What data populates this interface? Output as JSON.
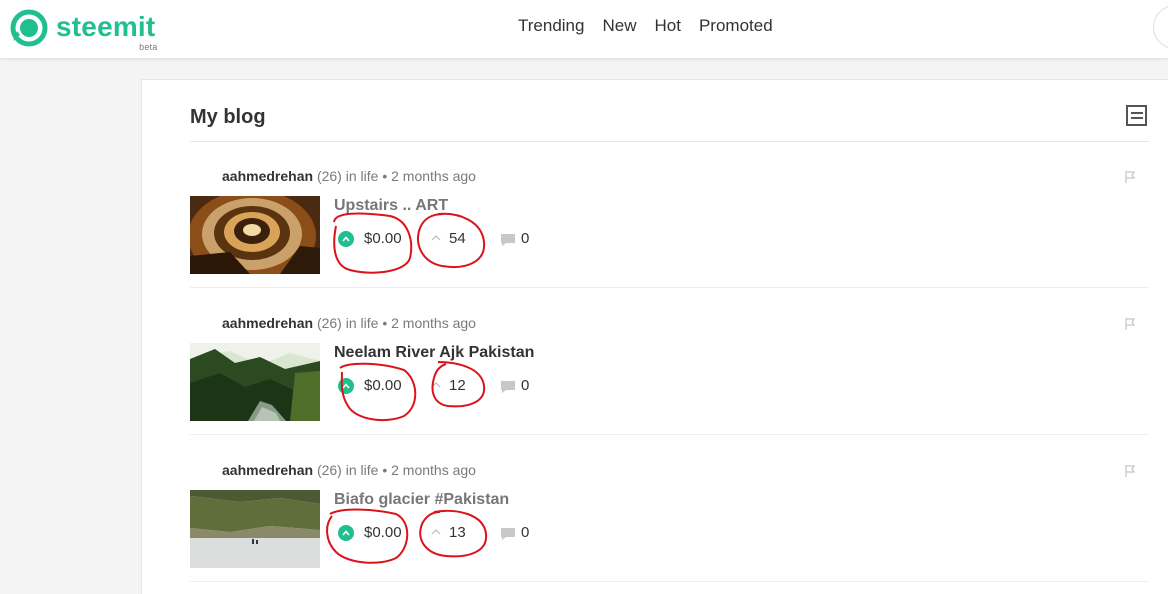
{
  "header": {
    "brand": "steemit",
    "brand_badge": "beta",
    "nav": [
      "Trending",
      "New",
      "Hot",
      "Promoted"
    ]
  },
  "blog": {
    "title": "My blog",
    "posts": [
      {
        "author": "aahmedrehan",
        "reputation": "(26)",
        "category_prefix": "in",
        "category": "life",
        "separator": "•",
        "time": "2 months ago",
        "title": "Upstairs .. ART",
        "payout": "$0.00",
        "voters": "54",
        "comments": "0"
      },
      {
        "author": "aahmedrehan",
        "reputation": "(26)",
        "category_prefix": "in",
        "category": "life",
        "separator": "•",
        "time": "2 months ago",
        "title": "Neelam River Ajk Pakistan",
        "payout": "$0.00",
        "voters": "12",
        "comments": "0"
      },
      {
        "author": "aahmedrehan",
        "reputation": "(26)",
        "category_prefix": "in",
        "category": "life",
        "separator": "•",
        "time": "2 months ago",
        "title": "Biafo glacier #Pakistan",
        "payout": "$0.00",
        "voters": "13",
        "comments": "0"
      }
    ]
  },
  "colors": {
    "brand": "#1fbf8f",
    "annotation": "#d9141b"
  },
  "icons": [
    "steemit-logo-icon",
    "layout-toggle-icon",
    "flag-icon",
    "upvote-icon",
    "voters-caret-icon",
    "comment-icon"
  ]
}
